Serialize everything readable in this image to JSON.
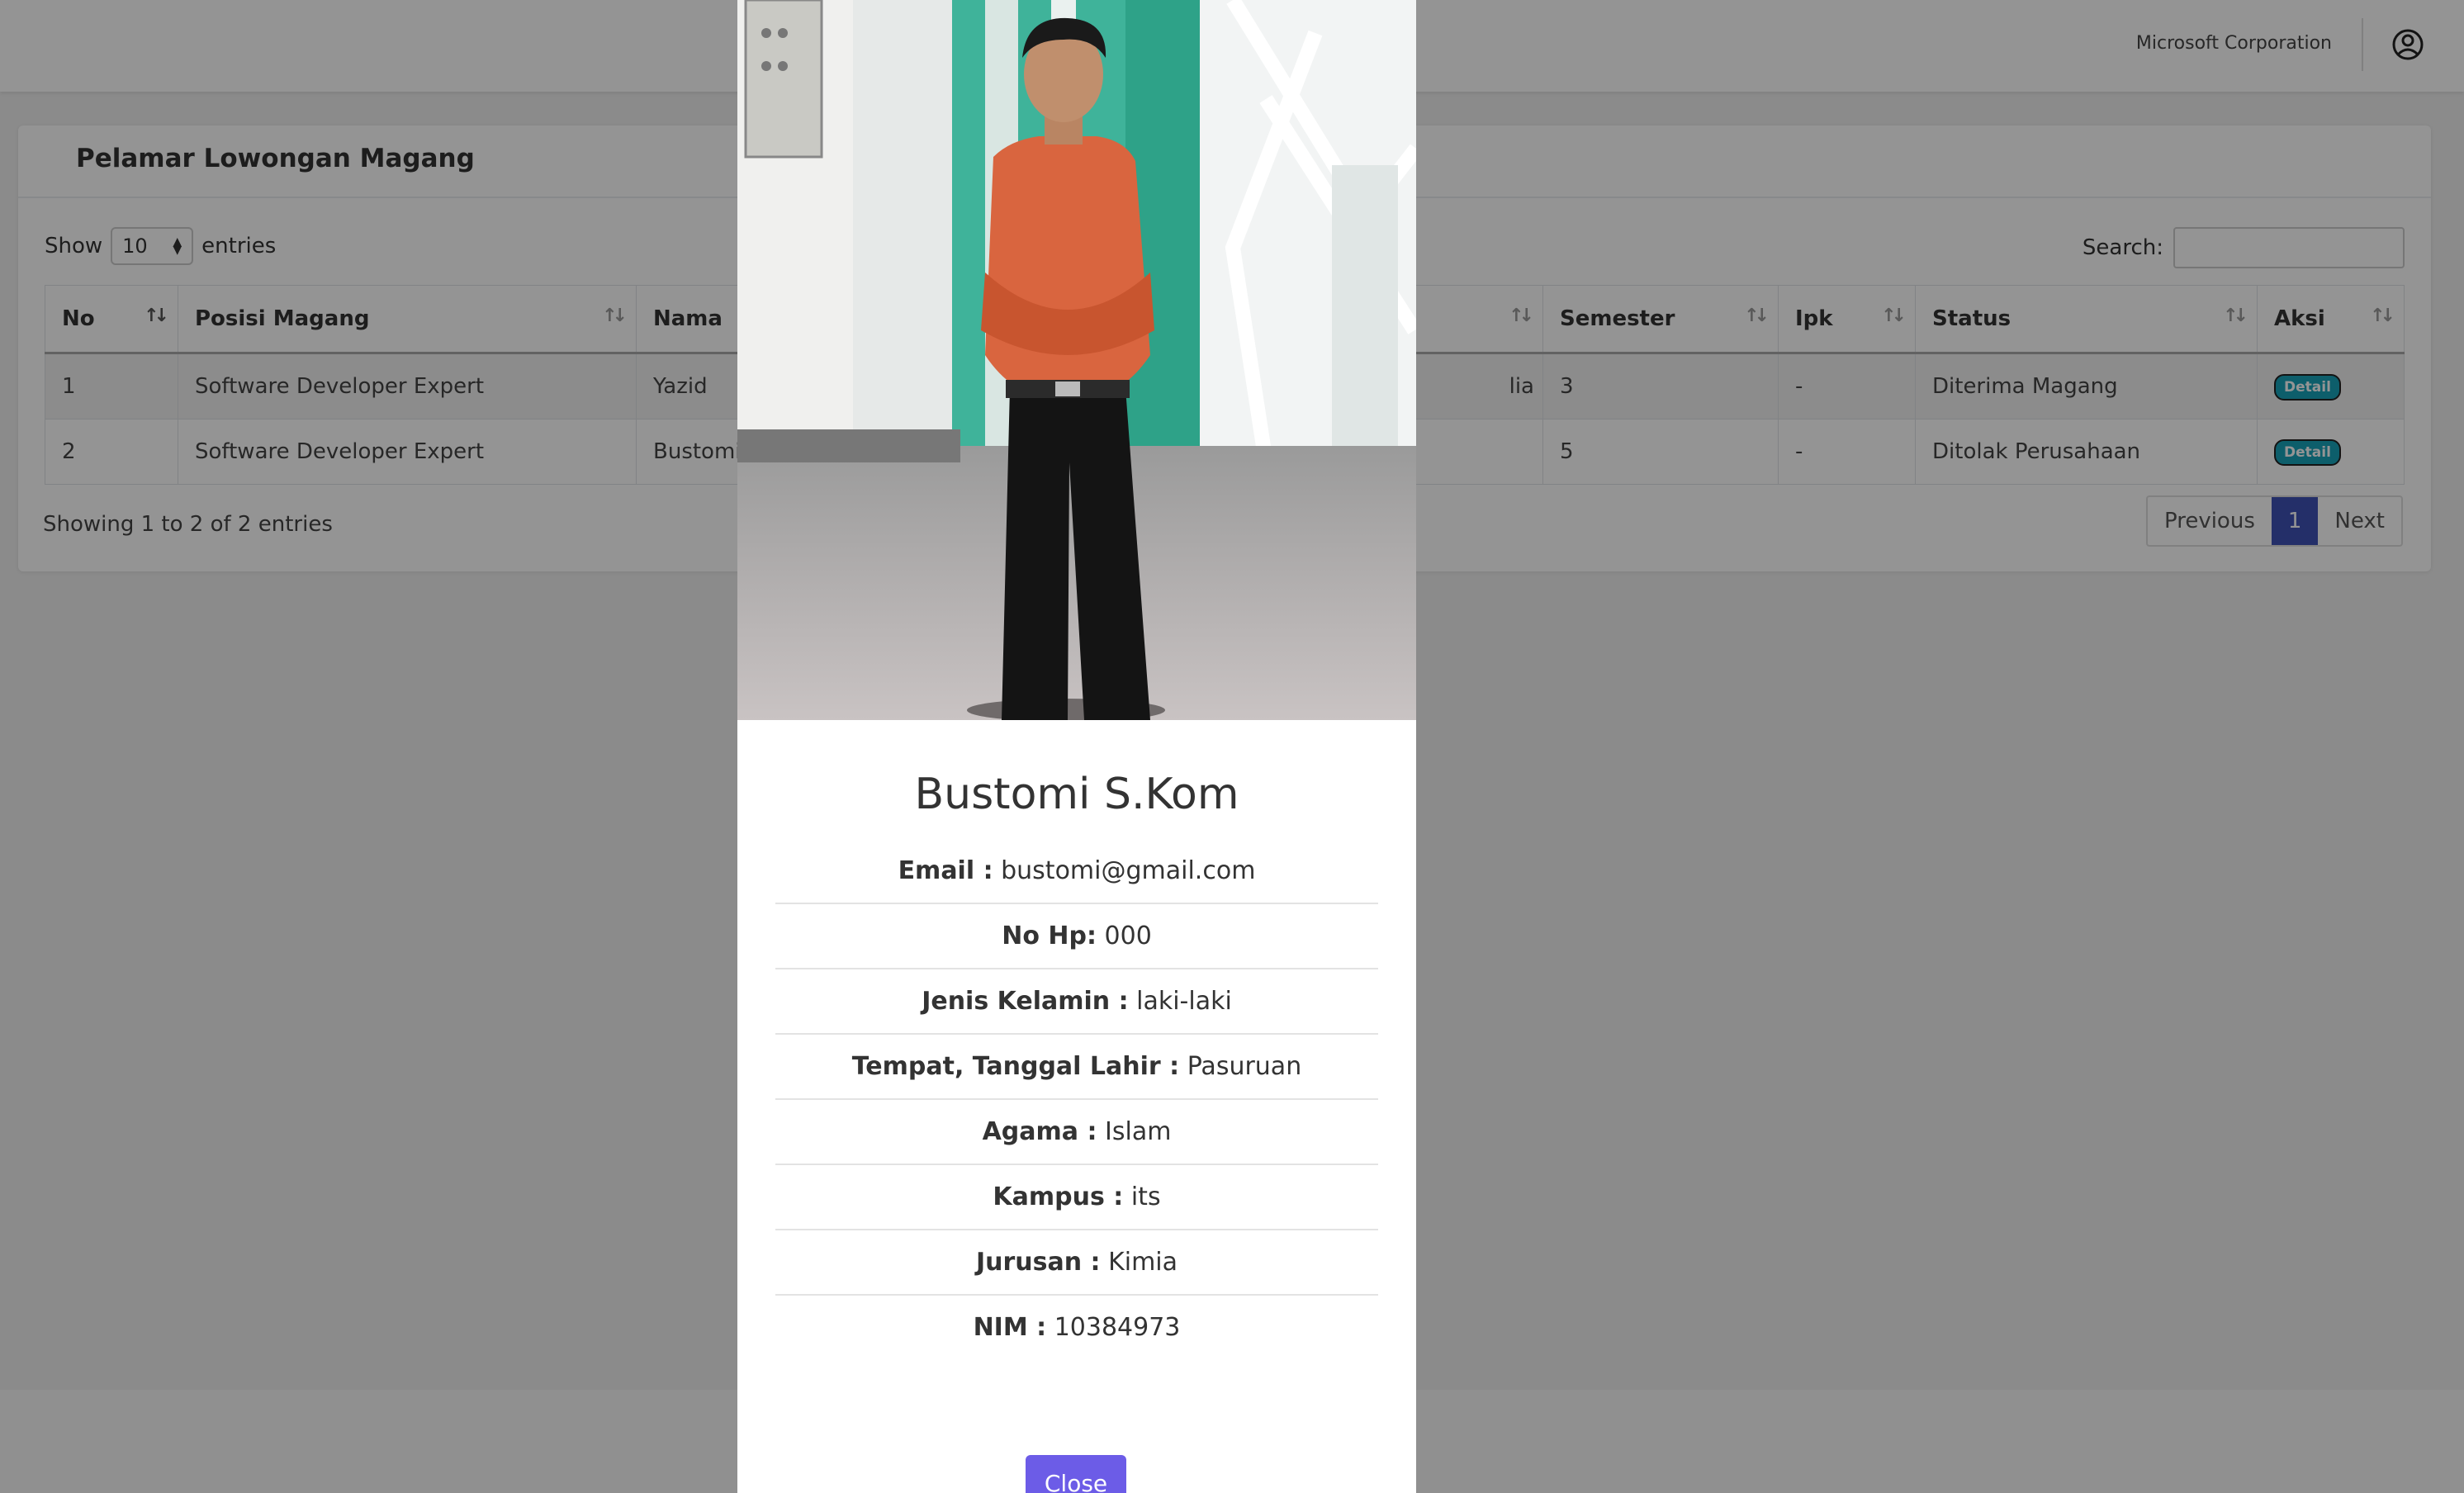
{
  "header": {
    "company": "Microsoft Corporation",
    "user_icon": "user-circle-icon"
  },
  "card": {
    "title": "Pelamar Lowongan Magang"
  },
  "length_control": {
    "show_label": "Show",
    "value": "10",
    "entries_label": "entries"
  },
  "search": {
    "label": "Search:",
    "value": ""
  },
  "table": {
    "columns": [
      "No",
      "Posisi Magang",
      "Nama",
      "Semester",
      "Ipk",
      "Status",
      "Aksi"
    ],
    "rows": [
      {
        "no": "1",
        "posisi": "Software Developer Expert",
        "nama": "Yazid",
        "partial": "lia",
        "semester": "3",
        "ipk": "-",
        "status": "Diterima Magang",
        "aksi": "Detail"
      },
      {
        "no": "2",
        "posisi": "Software Developer Expert",
        "nama": "Bustomi",
        "partial": "",
        "semester": "5",
        "ipk": "-",
        "status": "Ditolak Perusahaan",
        "aksi": "Detail"
      }
    ]
  },
  "info": "Showing 1 to 2 of 2 entries",
  "pagination": {
    "previous": "Previous",
    "current": "1",
    "next": "Next"
  },
  "modal": {
    "name": "Bustomi S.Kom",
    "fields": [
      {
        "label": "Email :",
        "value": "bustomi@gmail.com"
      },
      {
        "label": "No Hp:",
        "value": "000"
      },
      {
        "label": "Jenis Kelamin :",
        "value": "laki-laki"
      },
      {
        "label": "Tempat, Tanggal Lahir :",
        "value": "Pasuruan"
      },
      {
        "label": "Agama :",
        "value": "Islam"
      },
      {
        "label": "Kampus :",
        "value": "its"
      },
      {
        "label": "Jurusan :",
        "value": "Kimia"
      },
      {
        "label": "NIM :",
        "value": "10384973"
      }
    ],
    "close_label": "Close"
  },
  "colors": {
    "accent": "#3f51b5",
    "close_button": "#6c5ce7",
    "accepted": "#28a745",
    "rejected": "#dc3545",
    "detail_badge": "#17a2b8"
  }
}
